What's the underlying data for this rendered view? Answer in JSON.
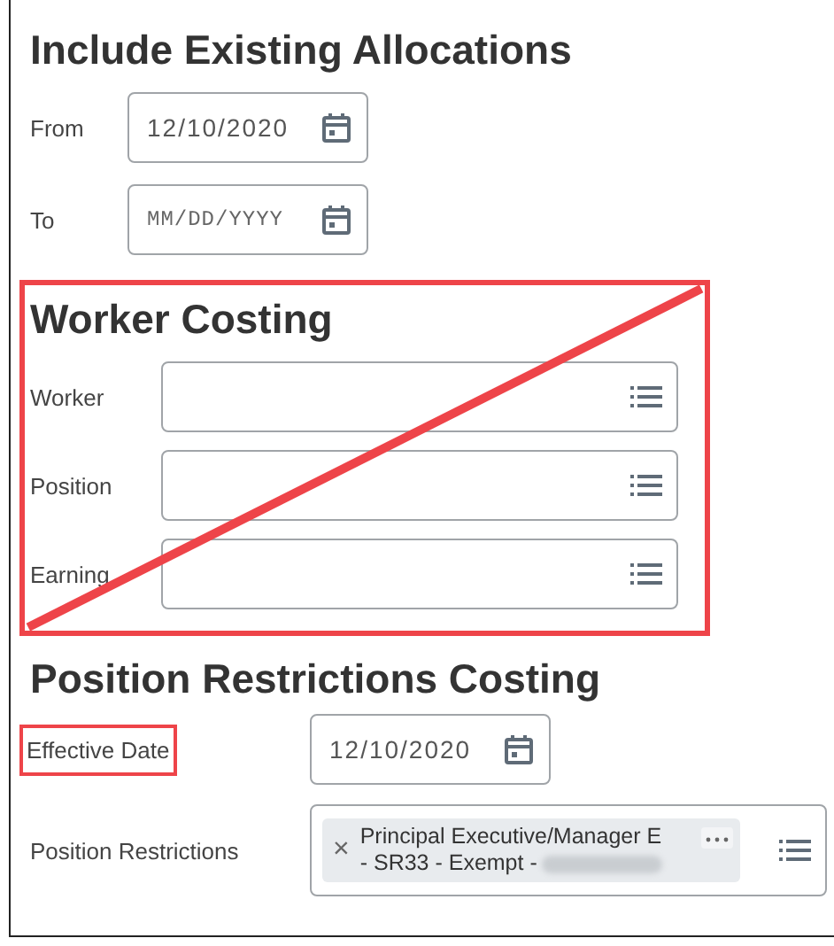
{
  "sections": [
    {
      "title": "Include Existing Allocations",
      "crossed_out": false,
      "fields": [
        {
          "kind": "date",
          "label": "From",
          "value": "12/10/2020",
          "label_highlighted": false
        },
        {
          "kind": "date",
          "label": "To",
          "placeholder": "MM/DD/YYYY",
          "label_highlighted": false
        }
      ]
    },
    {
      "title": "Worker Costing",
      "crossed_out": true,
      "fields": [
        {
          "kind": "prompt",
          "label": "Worker",
          "label_highlighted": false
        },
        {
          "kind": "prompt",
          "label": "Position",
          "label_highlighted": false
        },
        {
          "kind": "prompt",
          "label": "Earning",
          "label_highlighted": false
        }
      ]
    },
    {
      "title": "Position Restrictions Costing",
      "crossed_out": false,
      "fields": [
        {
          "kind": "date",
          "label": "Effective Date",
          "value": "12/10/2020",
          "label_highlighted": true
        },
        {
          "kind": "prompt",
          "label": "Position Restrictions",
          "label_highlighted": false,
          "chips": [
            {
              "remove": "×",
              "lines": [
                "Principal Executive/Manager E",
                "- SR33 - Exempt -"
              ],
              "redacted": true
            }
          ]
        }
      ]
    }
  ]
}
